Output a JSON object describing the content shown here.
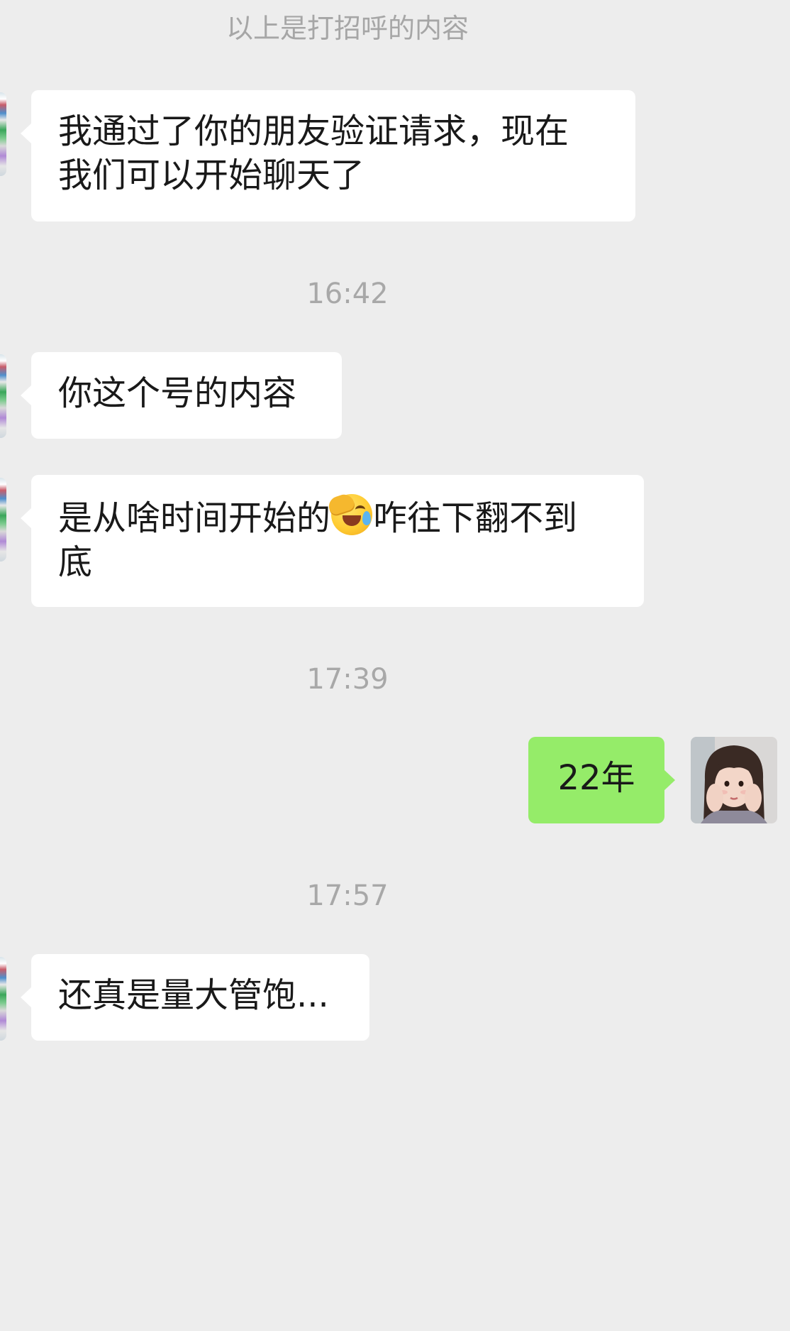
{
  "system_note": "以上是打招呼的内容",
  "messages": [
    {
      "direction": "in",
      "lines": [
        "我通过了你的朋友验证请求，现在",
        "我们可以开始聊天了"
      ]
    },
    {
      "type": "timestamp",
      "text": "16:42"
    },
    {
      "direction": "in",
      "text": "你这个号的内容"
    },
    {
      "direction": "in",
      "before_emoji": "是从啥时间开始的",
      "emoji": "face-palm-crying-emoji",
      "after_emoji": "咋往下翻不到",
      "second_line": "底"
    },
    {
      "type": "timestamp",
      "text": "17:39"
    },
    {
      "direction": "out",
      "text": "22年"
    },
    {
      "type": "timestamp",
      "text": "17:57"
    },
    {
      "direction": "in",
      "text": "还真是量大管饱..."
    }
  ],
  "colors": {
    "background": "#ededed",
    "incoming_bubble": "#ffffff",
    "outgoing_bubble": "#95ec69",
    "timestamp_text": "#a8a8a8",
    "message_text": "#191919"
  }
}
